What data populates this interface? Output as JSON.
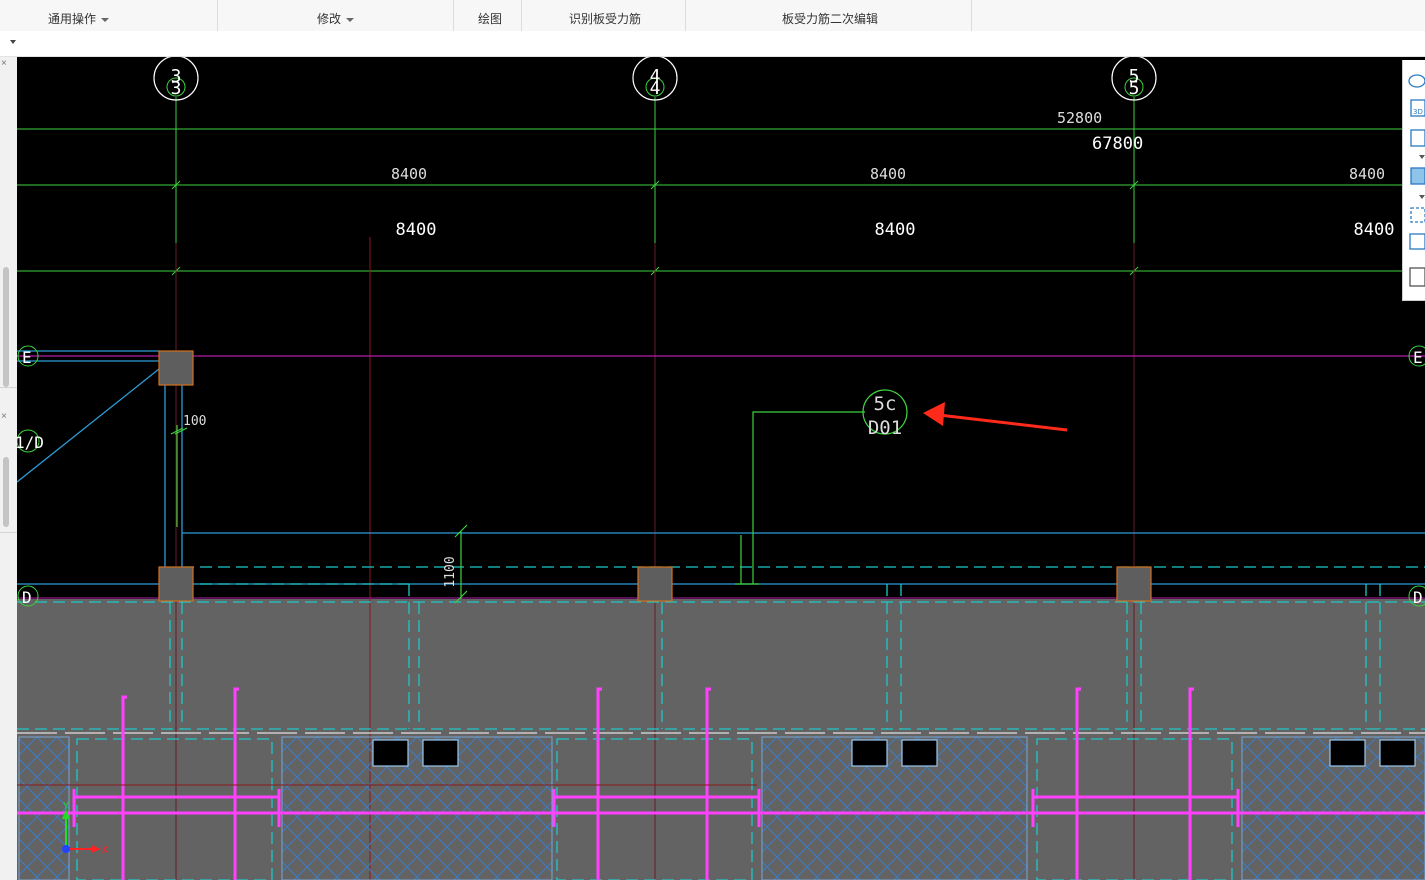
{
  "ribbon": {
    "general_ops": "通用操作",
    "modify": "修改",
    "draw": "绘图",
    "identify_slab_rebar": "识别板受力筋",
    "edit_slab_rebar": "板受力筋二次编辑"
  },
  "axis_labels": {
    "col3": "3",
    "col4": "4",
    "col5": "5",
    "rowE": "E",
    "rowE_right": "E",
    "row1D": "1/D",
    "rowD": "D",
    "rowD_right": "D"
  },
  "dimensions": {
    "total_52800": "52800",
    "total_67800": "67800",
    "span_small_1": "8400",
    "span_small_2": "8400",
    "span_small_3": "8400",
    "span_large_1": "8400",
    "span_large_2": "8400",
    "span_large_3": "8400",
    "dim_100": "100",
    "dim_1100": "1100"
  },
  "annotation": {
    "line1": "5c",
    "line2": "D01"
  },
  "axes_indicator": {
    "x": "X",
    "y": "Y"
  },
  "colors": {
    "canvas_bg": "#000000",
    "grid_green": "#3cd23c",
    "wall_cyan": "#2d9bd6",
    "column_fill": "#5e5e5e",
    "column_border": "#d07020",
    "slab_fill": "#636363",
    "magenta": "#ff40ff",
    "red_arrow": "#ff2a1a"
  }
}
